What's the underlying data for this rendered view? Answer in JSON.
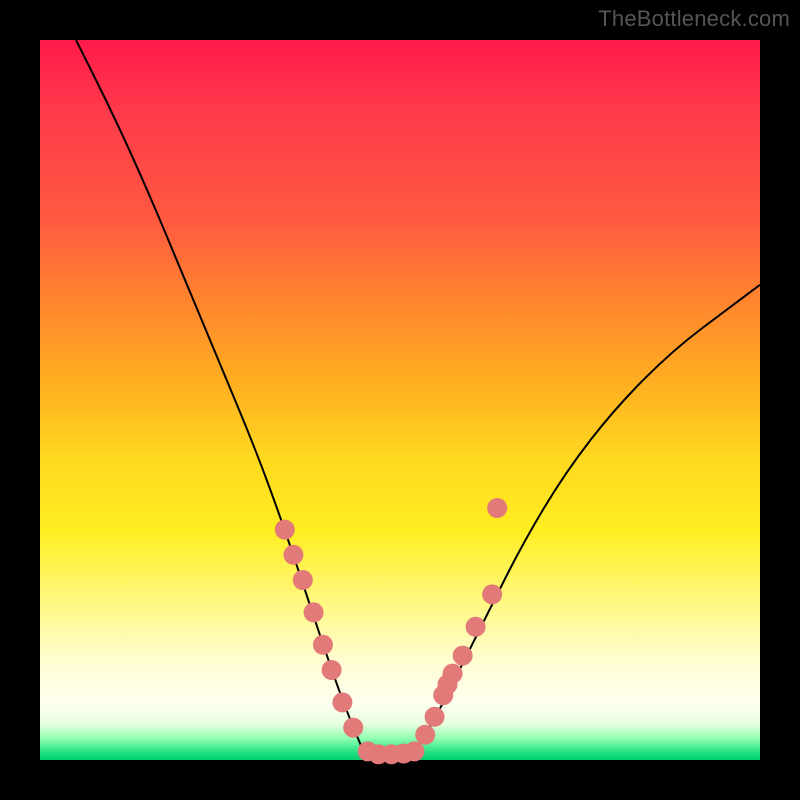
{
  "watermark": "TheBottleneck.com",
  "chart_data": {
    "type": "line",
    "title": "",
    "xlabel": "",
    "ylabel": "",
    "xlim": [
      0,
      100
    ],
    "ylim": [
      0,
      100
    ],
    "series": [
      {
        "name": "left-branch",
        "x": [
          5,
          10,
          15,
          20,
          25,
          30,
          34,
          37,
          40,
          42.5,
          45
        ],
        "y": [
          100,
          90,
          79,
          67,
          55,
          43,
          32,
          23,
          14,
          7,
          1
        ]
      },
      {
        "name": "right-branch",
        "x": [
          52,
          55,
          58,
          62,
          67,
          73,
          80,
          88,
          96,
          100
        ],
        "y": [
          1,
          6,
          12,
          20,
          30,
          40,
          49,
          57,
          63,
          66
        ]
      }
    ],
    "floor_segment": {
      "x": [
        45,
        52
      ],
      "y": [
        1,
        1
      ]
    },
    "marker_series": [
      {
        "name": "left-markers",
        "color": "#e27a7a",
        "points": [
          {
            "x": 34,
            "y": 32
          },
          {
            "x": 35.2,
            "y": 28.5
          },
          {
            "x": 36.5,
            "y": 25
          },
          {
            "x": 38,
            "y": 20.5
          },
          {
            "x": 39.3,
            "y": 16
          },
          {
            "x": 40.5,
            "y": 12.5
          },
          {
            "x": 42,
            "y": 8
          },
          {
            "x": 43.5,
            "y": 4.5
          }
        ]
      },
      {
        "name": "floor-markers",
        "color": "#e27a7a",
        "points": [
          {
            "x": 45.5,
            "y": 1.2
          },
          {
            "x": 47,
            "y": 0.8
          },
          {
            "x": 48.8,
            "y": 0.8
          },
          {
            "x": 50.5,
            "y": 0.9
          },
          {
            "x": 52,
            "y": 1.2
          }
        ]
      },
      {
        "name": "right-markers",
        "color": "#e27a7a",
        "points": [
          {
            "x": 53.5,
            "y": 3.5
          },
          {
            "x": 54.8,
            "y": 6
          },
          {
            "x": 56,
            "y": 9
          },
          {
            "x": 56.6,
            "y": 10.5
          },
          {
            "x": 57.3,
            "y": 12
          },
          {
            "x": 58.7,
            "y": 14.5
          },
          {
            "x": 60.5,
            "y": 18.5
          },
          {
            "x": 62.8,
            "y": 23
          },
          {
            "x": 63.5,
            "y": 35
          }
        ]
      }
    ]
  }
}
